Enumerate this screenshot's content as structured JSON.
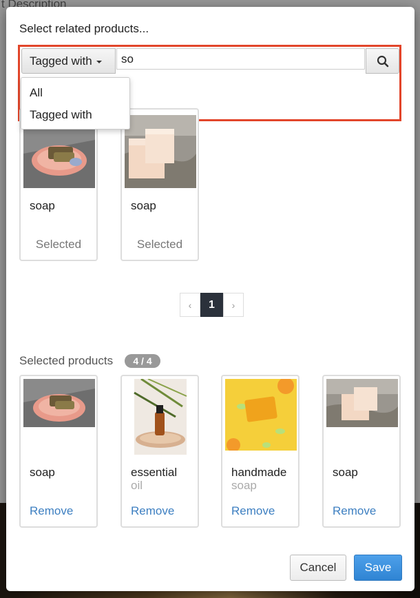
{
  "background": {
    "title_fragment": "t Description"
  },
  "modal": {
    "title": "Select related products..."
  },
  "search": {
    "filter_label": "Tagged with",
    "query": "so",
    "dropdown_options": [
      "All",
      "Tagged with"
    ]
  },
  "results": [
    {
      "name": "soap",
      "status": "Selected",
      "image": "soap-on-dish"
    },
    {
      "name": "soap",
      "status": "Selected",
      "image": "soap-bars-on-mat"
    }
  ],
  "pagination": {
    "prev": "‹",
    "current": "1",
    "next": "›"
  },
  "selected": {
    "label": "Selected products",
    "count": "4 / 4",
    "items": [
      {
        "name": "soap",
        "sub": "",
        "action": "Remove",
        "image": "soap-on-dish"
      },
      {
        "name": "essential",
        "sub": "oil",
        "action": "Remove",
        "image": "essential-oil-bottle"
      },
      {
        "name": "handmade",
        "sub": "soap",
        "action": "Remove",
        "image": "handmade-soap-yellow"
      },
      {
        "name": "soap",
        "sub": "",
        "action": "Remove",
        "image": "soap-bars-on-mat"
      }
    ]
  },
  "footer": {
    "cancel": "Cancel",
    "save": "Save"
  },
  "colors": {
    "highlight": "#e2452a",
    "primary": "#3d7fc1",
    "pager_active": "#2b313b",
    "badge": "#999999"
  }
}
